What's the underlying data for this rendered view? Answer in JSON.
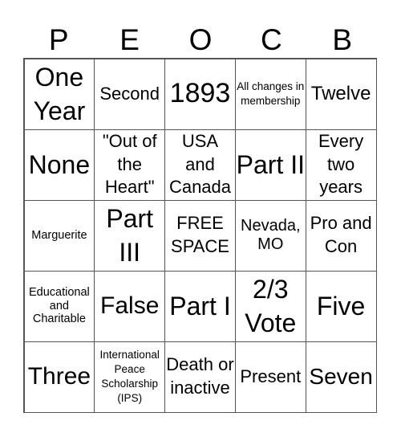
{
  "header": {
    "letters": [
      "P",
      "E",
      "O",
      "C",
      "B"
    ]
  },
  "cells": [
    "One Year",
    "Second",
    "1893",
    "All changes in membership",
    "Twelve",
    "None",
    "\"Out of the Heart\"",
    "USA and Canada",
    "Part II",
    "Every two years",
    "Marguerite",
    "Part III",
    "FREE SPACE",
    "Nevada, MO",
    "Pro and Con",
    "Educational and Charitable",
    "False",
    "Part I",
    "2/3 Vote",
    "Five",
    "Three",
    "International Peace Scholarship (IPS)",
    "Death or inactive",
    "Present",
    "Seven"
  ],
  "colors": {
    "border": "#555555",
    "text": "#000000",
    "background": "#ffffff"
  }
}
